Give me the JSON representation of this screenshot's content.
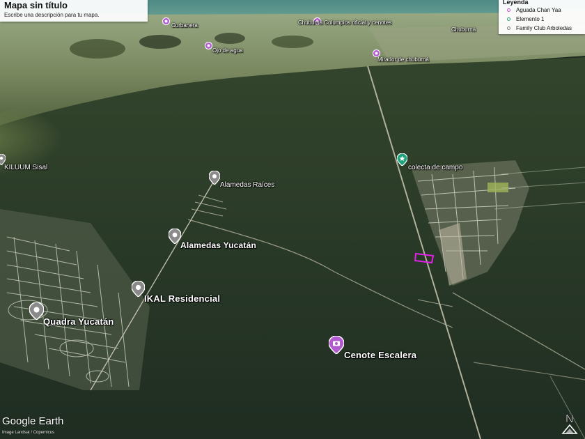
{
  "map": {
    "title": "Mapa sin título",
    "description": "Escribe una descripción para tu mapa."
  },
  "legend": {
    "heading": "Leyenda",
    "items": [
      {
        "label": "Aguada Chan Yaa",
        "color": "#c84bd1"
      },
      {
        "label": "Elemento 1",
        "color": "#1fa37a"
      },
      {
        "label": "Family Club Arboledas",
        "color": "#7a7a7a"
      }
    ]
  },
  "places": {
    "kiluum": "KILUUM Sisal",
    "alamedas_raices": "Alamedas Raíces",
    "alamedas_yucatan": "Alamedas Yucatán",
    "ikal": "IKAL Residencial",
    "quadra": "Quadra Yucatán",
    "cenote_escalera": "Cenote Escalera",
    "colecta": "colecta de campo",
    "mirador": "Mirador de chuburná",
    "ojo_agua": "Ojo de agua",
    "chuburna_cenotes": "Chuburná Columpios oficial y cenotes",
    "chuburna_town": "Chuburná",
    "curbanera": "Curbanera"
  },
  "branding": {
    "logo": "Google Earth",
    "credit": "Image Landsat / Copernicus",
    "compass": "N"
  },
  "colors": {
    "gray_pin": "#8a8a8a",
    "purple_pin": "#b35ad1",
    "green_pin": "#1fa37a",
    "polygon": "#e21fe8"
  }
}
